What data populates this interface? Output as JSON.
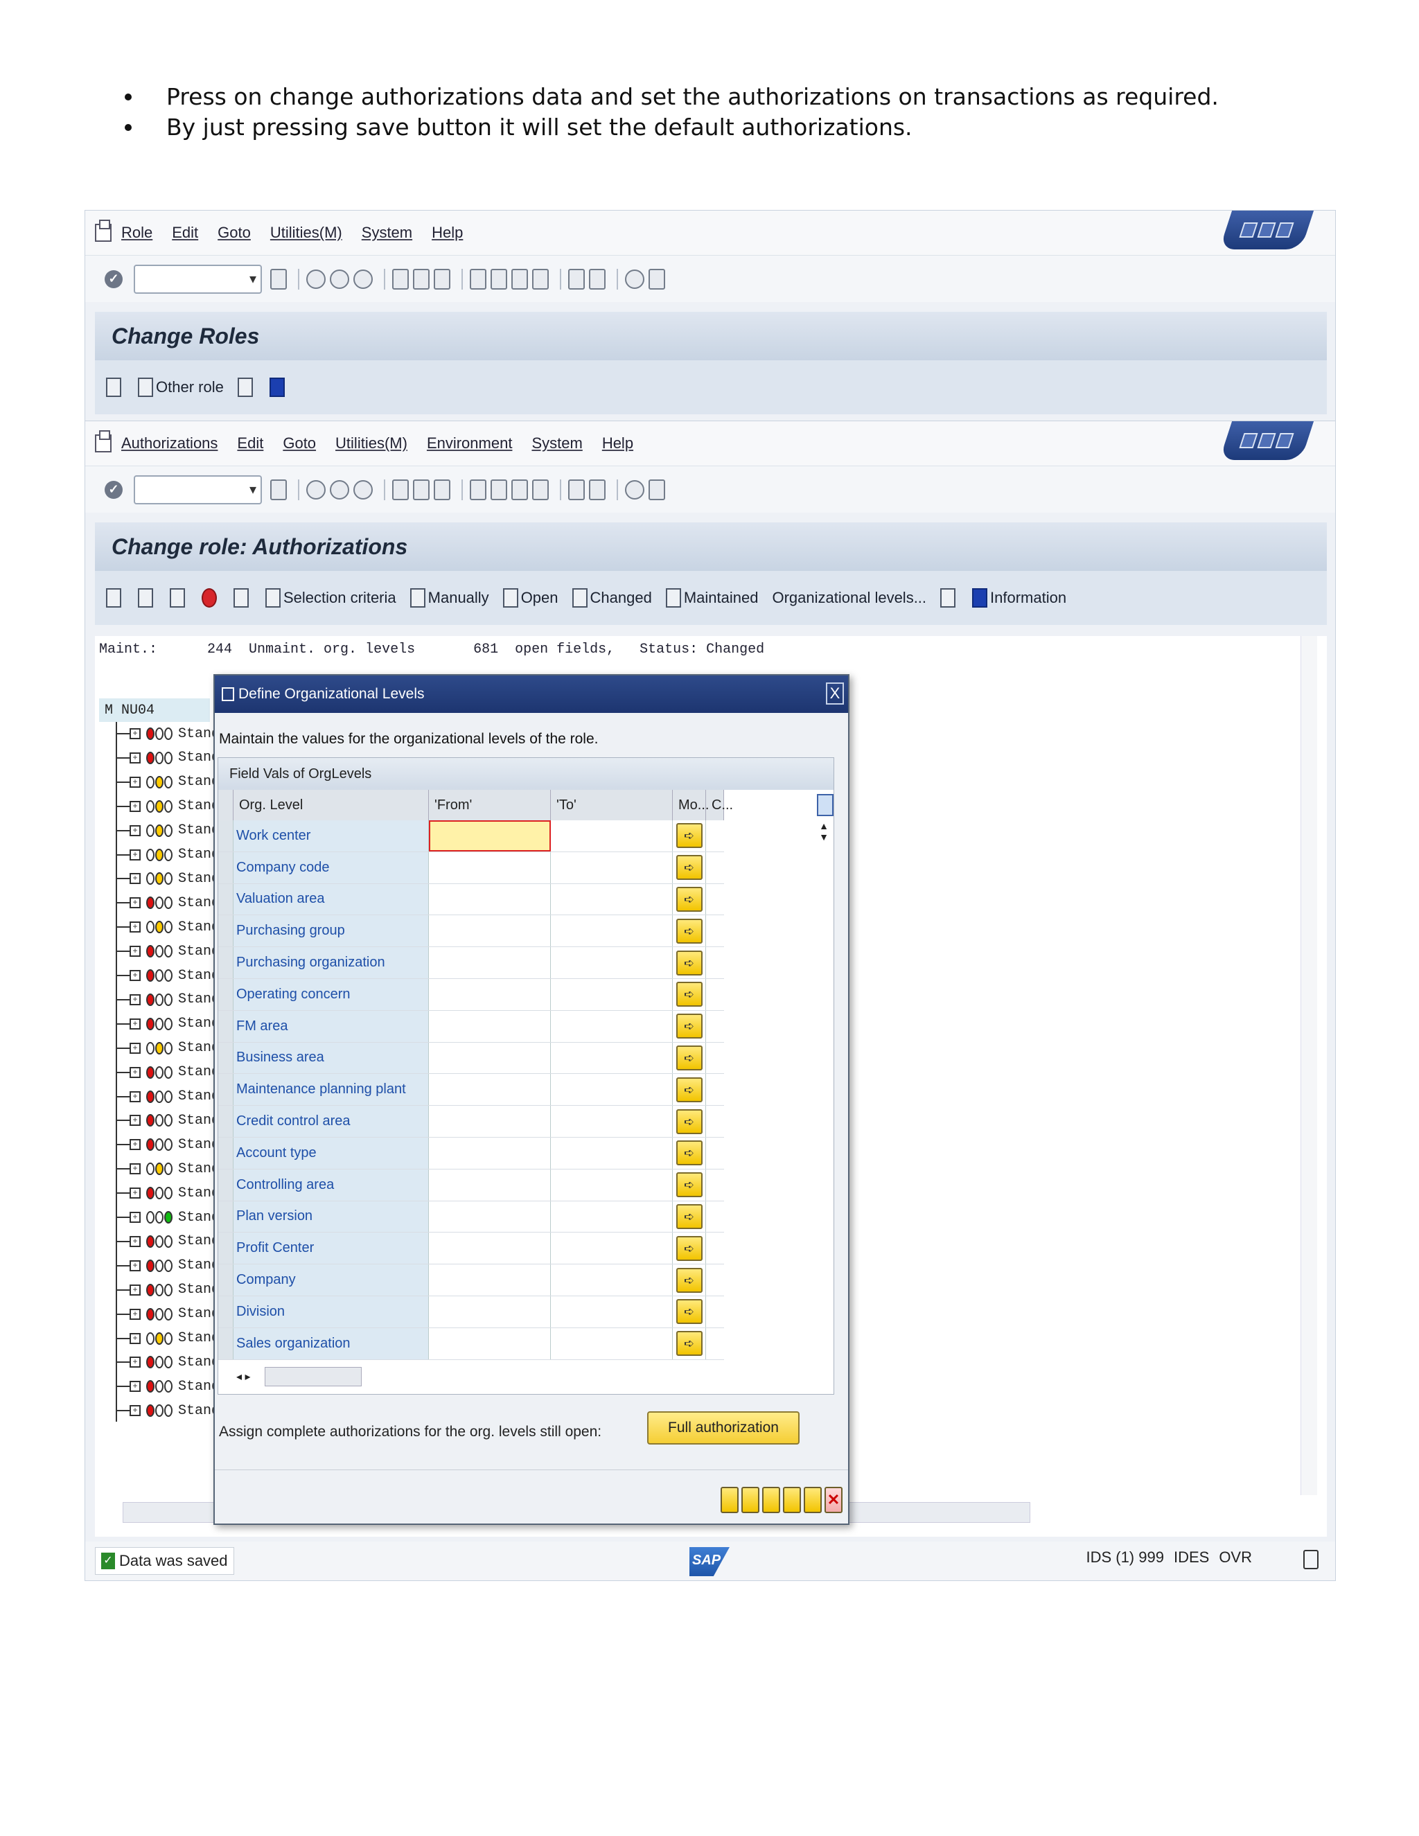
{
  "doc": {
    "bullets": [
      "Press on change authorizations data and set the authorizations on transactions as required.",
      "By just pressing save button it will set the default authorizations."
    ]
  },
  "win1": {
    "menu": [
      "Role",
      "Edit",
      "Goto",
      "Utilities(M)",
      "System",
      "Help"
    ],
    "title": "Change Roles",
    "app_toolbar": {
      "other_role": "Other role"
    }
  },
  "win2": {
    "menu": [
      "Authorizations",
      "Edit",
      "Goto",
      "Utilities(M)",
      "Environment",
      "System",
      "Help"
    ],
    "title": "Change role: Authorizations",
    "app_toolbar": [
      "Selection criteria",
      "Manually",
      "Open",
      "Changed",
      "Maintained",
      "Organizational levels...",
      "Information"
    ],
    "status_line": "Maint.:      244  Unmaint. org. levels       681  open fields,   Status: Changed",
    "node_id": "M NU04",
    "tree_label": "Stand",
    "tree_status": [
      "roo",
      "roo",
      "oyo",
      "oyo",
      "oyo",
      "oyo",
      "oyo",
      "roo",
      "oyo",
      "roo",
      "roo",
      "roo",
      "roo",
      "oyo",
      "roo",
      "roo",
      "roo",
      "roo",
      "oyo",
      "roo",
      "oog",
      "roo",
      "roo",
      "roo",
      "roo",
      "oyo",
      "roo",
      "roo",
      "roo"
    ]
  },
  "dialog": {
    "title": "Define Organizational Levels",
    "close": "X",
    "intro": "Maintain the values for the organizational levels of the role.",
    "table_caption": "Field Vals of OrgLevels",
    "columns": [
      "Org. Level",
      "'From'",
      "'To'",
      "Mo...",
      "C..."
    ],
    "rows": [
      "Work center",
      "Company code",
      "Valuation area",
      "Purchasing group",
      "Purchasing organization",
      "Operating concern",
      "FM area",
      "Business area",
      "Maintenance planning plant",
      "Credit control area",
      "Account type",
      "Controlling area",
      "Plan version",
      "Profit Center",
      "Company",
      "Division",
      "Sales organization"
    ],
    "assign_text": "Assign complete authorizations for the org. levels still open:",
    "full_auth": "Full authorization"
  },
  "status": {
    "message": "Data was saved",
    "logo": "SAP",
    "system": "IDS (1) 999",
    "client": "IDES",
    "mode": "OVR"
  }
}
